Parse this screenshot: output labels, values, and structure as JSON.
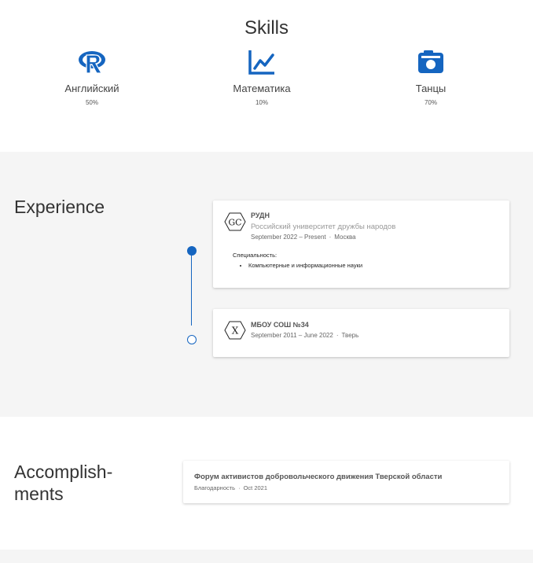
{
  "skills": {
    "title": "Skills",
    "items": [
      {
        "icon": "r-language-icon",
        "name": "Английский",
        "percent": "50%"
      },
      {
        "icon": "line-chart-icon",
        "name": "Математика",
        "percent": "10%"
      },
      {
        "icon": "camera-icon",
        "name": "Танцы",
        "percent": "70%"
      }
    ],
    "icon_color": "#1565c0"
  },
  "experience": {
    "title": "Experience",
    "accent_color": "#1565c0",
    "items": [
      {
        "logo_text": "GC",
        "org": "РУДН",
        "subtitle": "Российский университет дружбы народов",
        "dates": "September 2022 – Present",
        "location": "Москва",
        "spec_label": "Специальность:",
        "spec_items": [
          "Компьютерные и информационные науки"
        ]
      },
      {
        "logo_text": "X",
        "org": "МБОУ СОШ №34",
        "dates": "September 2011 – June 2022",
        "location": "Тверь"
      }
    ]
  },
  "accomplishments": {
    "title_line1": "Accomplish-",
    "title_line2": "ments",
    "items": [
      {
        "title": "Форум активистов добровольческого движения Тверской области",
        "type": "Благодарность",
        "date": "Oct 2021"
      }
    ]
  },
  "separator": "·"
}
